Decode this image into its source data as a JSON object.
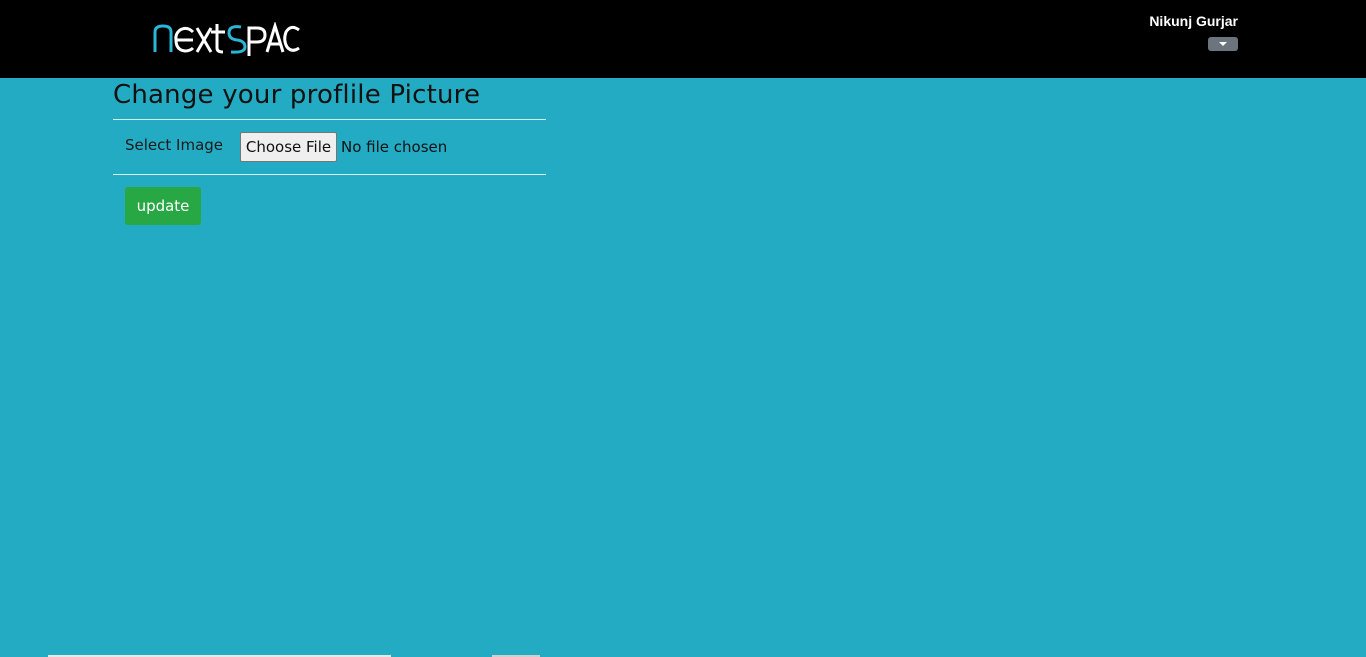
{
  "header": {
    "logo_text": "nextspace",
    "user_name": "Nikunj Gurjar"
  },
  "main": {
    "title": "Change your proflile Picture",
    "select_label": "Select Image",
    "file_button_label": "Choose File",
    "file_status": "No file chosen",
    "update_label": "update"
  },
  "colors": {
    "background": "#23abc3",
    "header": "#000000",
    "logo_accent": "#2ab6d6",
    "update_button": "#28a745",
    "dropdown": "#6c757d"
  },
  "icons": {
    "dropdown": "caret-down-icon"
  }
}
